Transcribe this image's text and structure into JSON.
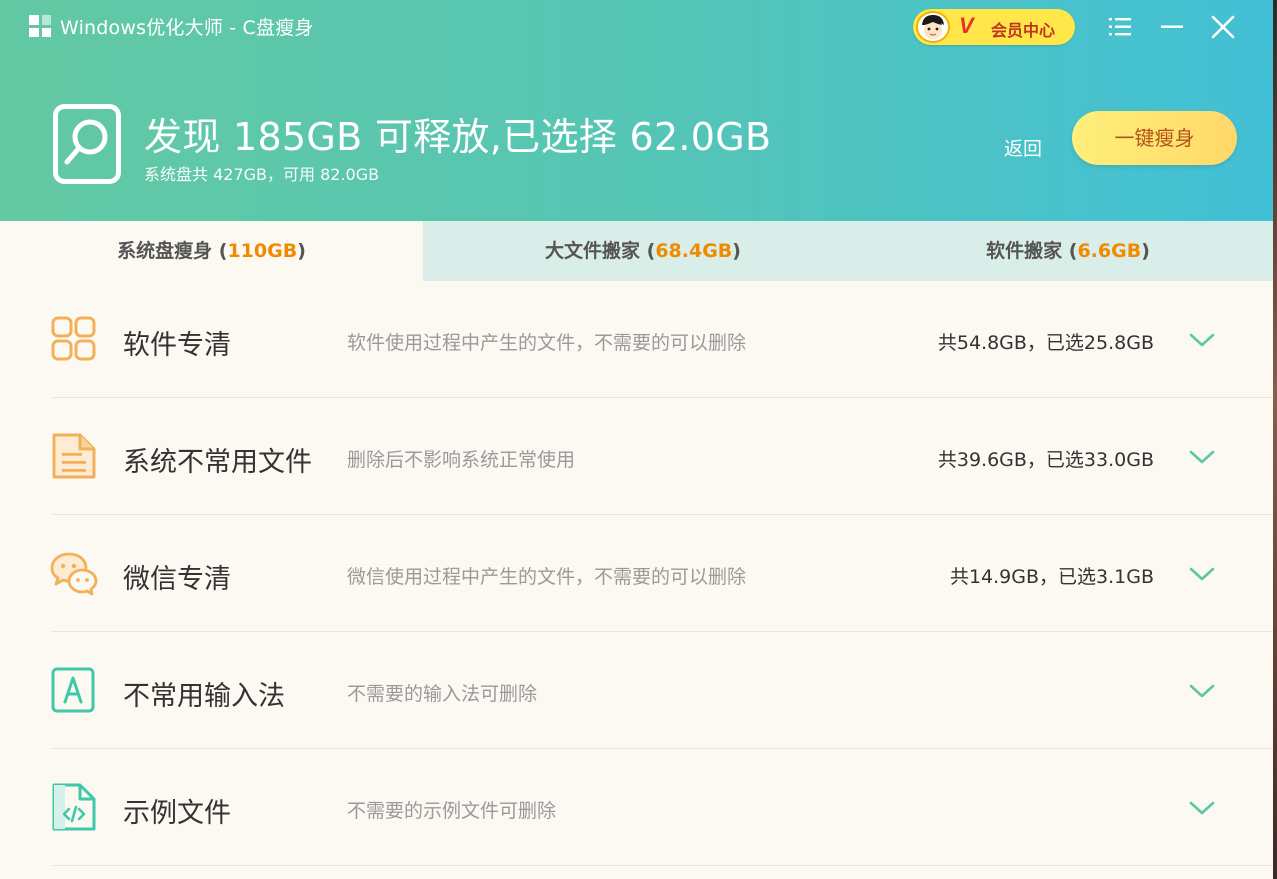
{
  "window": {
    "title": "Windows优化大师 - C盘瘦身"
  },
  "vip": {
    "badge": "V",
    "label": "会员中心"
  },
  "summary": {
    "headline": "发现 185GB 可释放,已选择 62.0GB",
    "disk_info": "系统盘共 427GB，可用 82.0GB"
  },
  "actions": {
    "back_label": "返回",
    "slim_label": "一键瘦身"
  },
  "tabs": [
    {
      "label": "系统盘瘦身",
      "open": " (",
      "amount": "110GB",
      "close": ")"
    },
    {
      "label": "大文件搬家",
      "open": " (",
      "amount": "68.4GB",
      "close": ")"
    },
    {
      "label": "软件搬家",
      "open": " (",
      "amount": "6.6GB",
      "close": ")"
    }
  ],
  "items": [
    {
      "name": "软件专清",
      "description": "软件使用过程中产生的文件，不需要的可以删除",
      "size": "共54.8GB，已选25.8GB",
      "icon": "apps-grid-icon"
    },
    {
      "name": "系统不常用文件",
      "description": "删除后不影响系统正常使用",
      "size": "共39.6GB，已选33.0GB",
      "icon": "document-icon"
    },
    {
      "name": "微信专清",
      "description": "微信使用过程中产生的文件，不需要的可以删除",
      "size": "共14.9GB，已选3.1GB",
      "icon": "wechat-icon"
    },
    {
      "name": "不常用输入法",
      "description": "不需要的输入法可删除",
      "size": "",
      "icon": "input-method-icon"
    },
    {
      "name": "示例文件",
      "description": "不需要的示例文件可删除",
      "size": "",
      "icon": "code-file-icon"
    }
  ],
  "colors": {
    "header_start": "#63c9a3",
    "header_end": "#42c0d6",
    "accent_orange": "#f08a00",
    "icon_orange": "#f3b05a",
    "icon_teal": "#3fc8a8",
    "chevron": "#5cc6a6",
    "vip_yellow": "#ffe74a"
  }
}
